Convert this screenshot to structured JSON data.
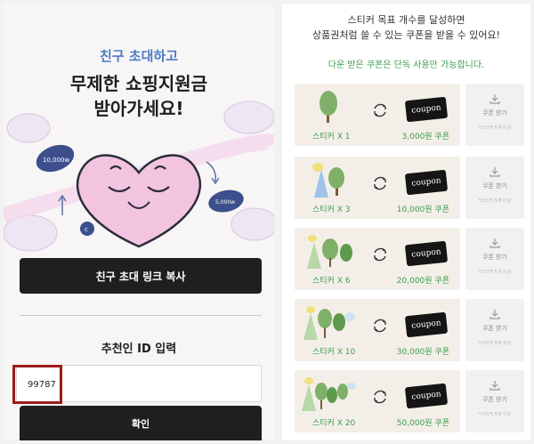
{
  "left": {
    "subtitle": "친구 초대하고",
    "title_line1": "무제한 쇼핑지원금",
    "title_line2": "받아가세요!",
    "coin_left": "10,000w",
    "coin_right": "5,000w",
    "coin_small": "c",
    "copy_link_label": "친구 초대 링크 복사",
    "referrer_label": "추천인 ID 입력",
    "referrer_value": "99787",
    "confirm_label": "확인"
  },
  "right": {
    "goal_line1": "스티커 목표 개수를 달성하면",
    "goal_line2": "상품권처럼 쓸 수 있는 쿠폰을 받을 수 있어요!",
    "notice": "다운 받은 쿠폰은 단독 사용만 가능합니다.",
    "coupon_text": "coupon",
    "download_label": "쿠폰 받기",
    "download_note": "*스티커 5개 이상",
    "tiers": [
      {
        "label": "스티커 X 1",
        "reward": "3,000원 쿠폰"
      },
      {
        "label": "스티커 X 3",
        "reward": "10,000원 쿠폰"
      },
      {
        "label": "스티커 X 6",
        "reward": "20,000원 쿠폰"
      },
      {
        "label": "스티커 X 10",
        "reward": "30,000원 쿠폰"
      },
      {
        "label": "스티커 X 20",
        "reward": "50,000원 쿠폰"
      }
    ]
  },
  "colors": {
    "accent_blue": "#4f7bc4",
    "accent_green": "#3c9c52",
    "highlight_red": "#9e1b1b",
    "button_dark": "#1f1f1f",
    "heart_pink": "#f2c4e0"
  },
  "icons": [
    "heart-character",
    "coin-icon",
    "swap-arrows-icon",
    "download-icon",
    "tree-sticker-icon"
  ]
}
